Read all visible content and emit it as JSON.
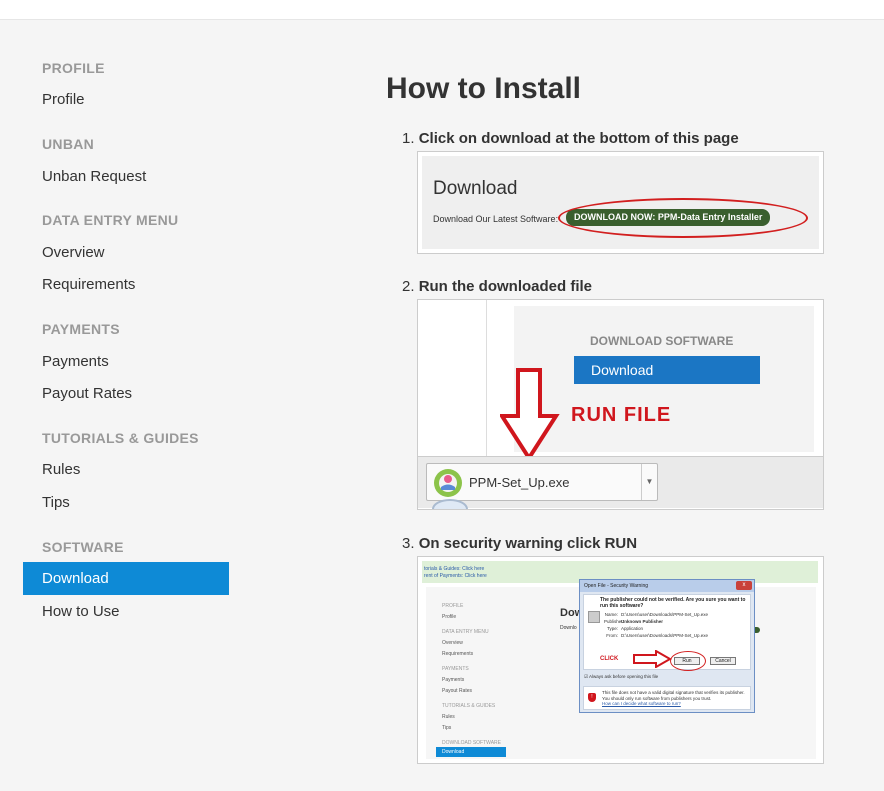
{
  "sidebar": {
    "sections": [
      {
        "heading": "PROFILE",
        "items": [
          "Profile"
        ]
      },
      {
        "heading": "UNBAN",
        "items": [
          "Unban Request"
        ]
      },
      {
        "heading": "DATA ENTRY MENU",
        "items": [
          "Overview",
          "Requirements"
        ]
      },
      {
        "heading": "PAYMENTS",
        "items": [
          "Payments",
          "Payout Rates"
        ]
      },
      {
        "heading": "TUTORIALS & GUIDES",
        "items": [
          "Rules",
          "Tips"
        ]
      },
      {
        "heading": "SOFTWARE",
        "items": [
          "Download",
          "How to Use"
        ]
      }
    ],
    "active_item": "Download",
    "active_color": "#0e8ad6"
  },
  "main": {
    "title": "How to Install",
    "steps": [
      {
        "number": "1.",
        "text": "Click on download at the bottom of this page"
      },
      {
        "number": "2.",
        "text": "Run the downloaded file"
      },
      {
        "number": "3.",
        "text": "On security warning click RUN"
      }
    ]
  },
  "shot1": {
    "title": "Download",
    "text": "Download Our Latest Software:",
    "button": "DOWNLOAD NOW: PPM-Data Entry Installer"
  },
  "shot2": {
    "heading": "DOWNLOAD SOFTWARE",
    "button": "Download",
    "annotation": "RUN FILE",
    "filename": "PPM-Set_Up.exe"
  },
  "shot3": {
    "green_lines": [
      "torials & Guides: Click here",
      "rent of Payments: Click here"
    ],
    "sidebar_items": [
      {
        "text": "PROFILE",
        "head": true
      },
      {
        "text": "Profile",
        "head": false
      },
      {
        "text": "DATA ENTRY MENU",
        "head": true
      },
      {
        "text": "Overview",
        "head": false
      },
      {
        "text": "Requirements",
        "head": false
      },
      {
        "text": "PAYMENTS",
        "head": true
      },
      {
        "text": "Payments",
        "head": false
      },
      {
        "text": "Payout Rates",
        "head": false
      },
      {
        "text": "TUTORIALS & GUIDES",
        "head": true
      },
      {
        "text": "Rules",
        "head": false
      },
      {
        "text": "Tips",
        "head": false
      },
      {
        "text": "DOWNLOAD SOFTWARE",
        "head": true
      }
    ],
    "active_item": "Download",
    "page_title": "Dow",
    "page_text": "Downlo",
    "dialog": {
      "title": "Open File - Security Warning",
      "close": "x",
      "question": "The publisher could not be verified. Are you sure you want to run this software?",
      "rows": [
        {
          "key": "Name:",
          "value": "D:\\Users\\user\\Downloads\\PPM-Set_Up.exe"
        },
        {
          "key": "Publisher:",
          "value": "Unknown Publisher"
        },
        {
          "key": "Type:",
          "value": "Application"
        },
        {
          "key": "From:",
          "value": "D:\\Users\\user\\Downloads\\PPM-Set_Up.exe"
        }
      ],
      "run": "Run",
      "cancel": "Cancel",
      "click_label": "CLICK",
      "checkbox": "Always ask before opening this file",
      "warning": "This file does not have a valid digital signature that verifies its publisher. You should only run software from publishers you trust.",
      "warning_link": "How can I decide what software to run?"
    }
  }
}
